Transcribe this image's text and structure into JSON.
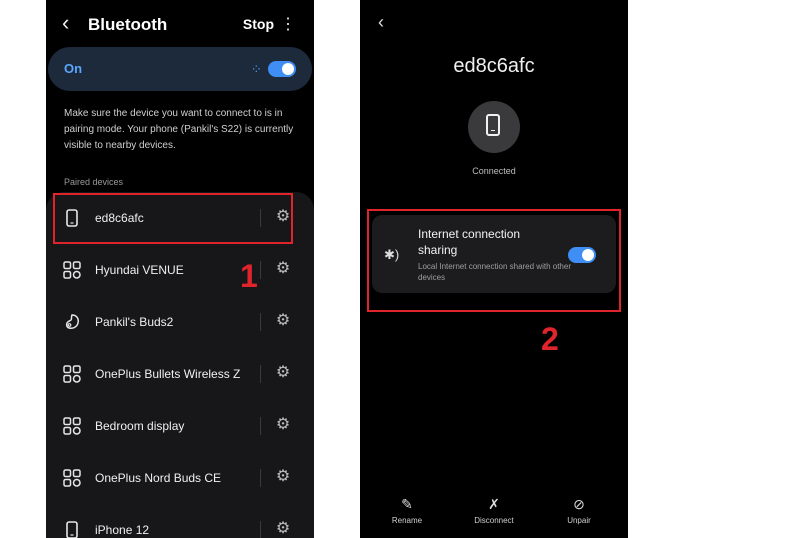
{
  "left": {
    "header": {
      "back_icon": "back-arrow-icon",
      "title": "Bluetooth",
      "stop_label": "Stop",
      "more_icon": "more-vert-icon"
    },
    "switch": {
      "label": "On",
      "on": true
    },
    "info_text": "Make sure the device you want to connect to is in pairing mode. Your phone (Pankil's S22) is currently visible to nearby devices.",
    "section_label": "Paired devices",
    "devices": [
      {
        "name": "ed8c6afc",
        "icon": "phone-icon"
      },
      {
        "name": "Hyundai VENUE",
        "icon": "apps-icon"
      },
      {
        "name": "Pankil's Buds2",
        "icon": "earbud-icon"
      },
      {
        "name": "OnePlus Bullets Wireless Z",
        "icon": "apps-icon"
      },
      {
        "name": "Bedroom display",
        "icon": "apps-icon"
      },
      {
        "name": "OnePlus Nord Buds CE",
        "icon": "apps-icon"
      },
      {
        "name": "iPhone 12",
        "icon": "phone-icon"
      }
    ],
    "marker": "1"
  },
  "right": {
    "device_name": "ed8c6afc",
    "status": "Connected",
    "sharing": {
      "title": "Internet connection sharing",
      "description": "Local Internet connection shared with other devices",
      "on": true
    },
    "actions": [
      {
        "label": "Rename",
        "icon": "pencil-icon"
      },
      {
        "label": "Disconnect",
        "icon": "bluetooth-off-icon"
      },
      {
        "label": "Unpair",
        "icon": "unlink-icon"
      }
    ],
    "marker": "2"
  },
  "colors": {
    "accent": "#3f8ef5",
    "highlight": "#e0242c",
    "background": "#000000"
  }
}
